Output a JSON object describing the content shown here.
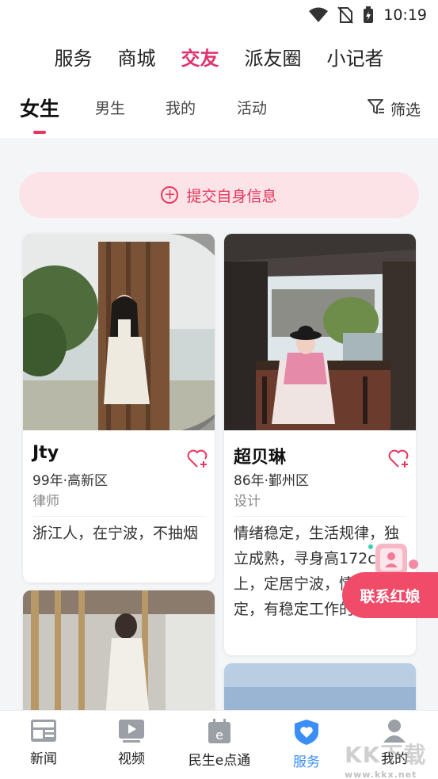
{
  "status": {
    "time": "10:19"
  },
  "channels": [
    {
      "label": "服务"
    },
    {
      "label": "商城"
    },
    {
      "label": "交友",
      "active": true
    },
    {
      "label": "派友圈"
    },
    {
      "label": "小记者"
    }
  ],
  "subtabs": {
    "items": [
      "女生",
      "男生",
      "我的",
      "活动"
    ],
    "active_index": 0,
    "filter_label": "筛选"
  },
  "submit_label": "提交自身信息",
  "profiles": [
    {
      "name": "Jty",
      "meta": "99年·高新区",
      "job": "律师",
      "desc": "浙江人，在宁波，不抽烟"
    },
    {
      "name": "超贝琳",
      "meta": "86年·鄞州区",
      "job": "设计",
      "desc": "情绪稳定，生活规律，独立成熟，寻身高172cm以上，定居宁波，情绪稳定，有稳定工作的男士。"
    }
  ],
  "float_button": "联系红娘",
  "bottom_nav": [
    {
      "label": "新闻",
      "icon": "news-icon"
    },
    {
      "label": "视频",
      "icon": "video-icon"
    },
    {
      "label": "民生e点通",
      "icon": "calendar-e-icon"
    },
    {
      "label": "服务",
      "icon": "heart-shield-icon",
      "active": true
    },
    {
      "label": "我的",
      "icon": "user-icon"
    }
  ],
  "watermark": {
    "main": "KK下载",
    "sub": "www.kkx.net"
  },
  "colors": {
    "accent": "#e8365e",
    "nav_active": "#3a8ef6",
    "background": "#f4f5f7"
  }
}
